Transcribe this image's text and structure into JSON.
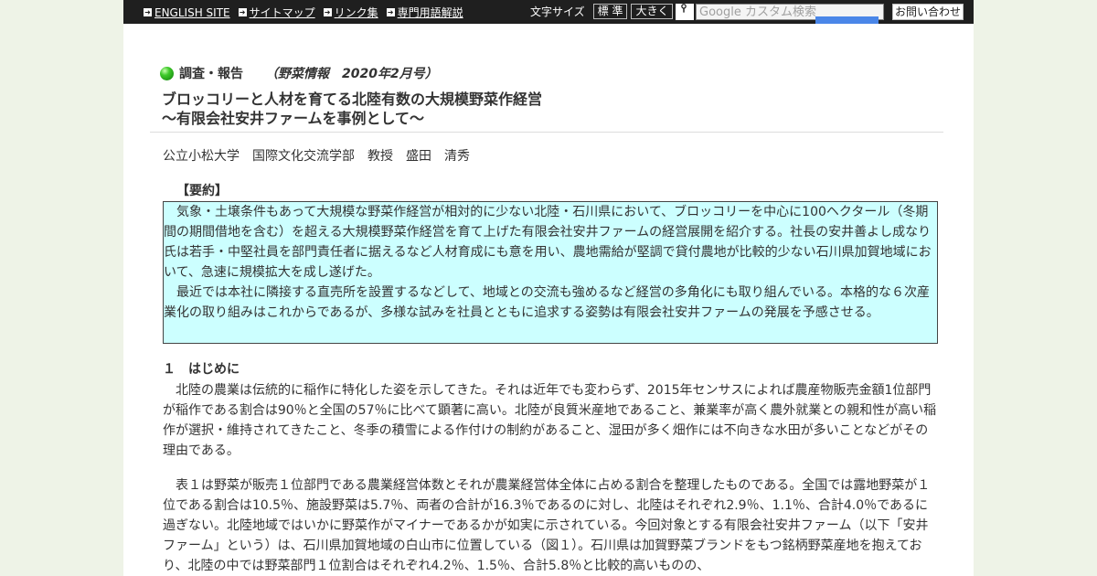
{
  "topnav": {
    "items": [
      {
        "label": "ENGLISH SITE"
      },
      {
        "label": "サイトマップ"
      },
      {
        "label": "リンク集"
      },
      {
        "label": "専門用語解説"
      }
    ],
    "font_size_label": "文字サイズ",
    "font_standard": "標 準",
    "font_large": "大きく",
    "search_placeholder": "Google カスタム検索",
    "contact": "お問い合わせ"
  },
  "article": {
    "section": "調査・報告",
    "source": "（野菜情報　2020年2月号）",
    "title_line1": "ブロッコリーと人材を育てる北陸有数の大規模野菜作経営",
    "title_line2": "～有限会社安井ファームを事例として～",
    "author": "公立小松大学　国際文化交流学部　教授　盛田　清秀",
    "summary_heading": "【要約】",
    "summary_p1": "気象・土壌条件もあって大規模な野菜作経営が相対的に少ない北陸・石川県において、ブロッコリーを中心に100ヘクタール（冬期間の期間借地を含む）を超える大規模野菜作経営を育て上げた有限会社安井ファームの経営展開を紹介する。社長の安井善よし成なり氏は若手・中堅社員を部門責任者に据えるなど人材育成にも意を用い、農地需給が堅調で貸付農地が比較的少ない石川県加賀地域において、急速に規模拡大を成し遂げた。",
    "summary_p2": "最近では本社に隣接する直売所を設置するなどして、地域との交流も強めるなど経営の多角化にも取り組んでいる。本格的な６次産業化の取り組みはこれからであるが、多様な試みを社員とともに追求する姿勢は有限会社安井ファームの発展を予感させる。",
    "sec1_heading": "１　はじめに",
    "para1": "北陸の農業は伝統的に稲作に特化した姿を示してきた。それは近年でも変わらず、2015年センサスによれば農産物販売金額1位部門が稲作である割合は90％と全国の57％に比べて顕著に高い。北陸が良質米産地であること、兼業率が高く農外就業との親和性が高い稲作が選択・維持されてきたこと、冬季の積雪による作付けの制約があること、湿田が多く畑作には不向きな水田が多いことなどがその理由である。",
    "para2": "表１は野菜が販売１位部門である農業経営体数とそれが農業経営体全体に占める割合を整理したものである。全国では露地野菜が１位である割合は10.5％、施設野菜は5.7％、両者の合計が16.3％であるのに対し、北陸はそれぞれ2.9％、1.1％、合計4.0％であるに過ぎない。北陸地域ではいかに野菜作がマイナーであるかが如実に示されている。今回対象とする有限会社安井ファーム（以下「安井ファーム」という）は、石川県加賀地域の白山市に位置している（図１）。石川県は加賀野菜ブランドをもつ銘柄野菜産地を抱えており、北陸の中では野菜部門１位割合はそれぞれ4.2％、1.5％、合計5.8％と比較的高いものの、"
  }
}
